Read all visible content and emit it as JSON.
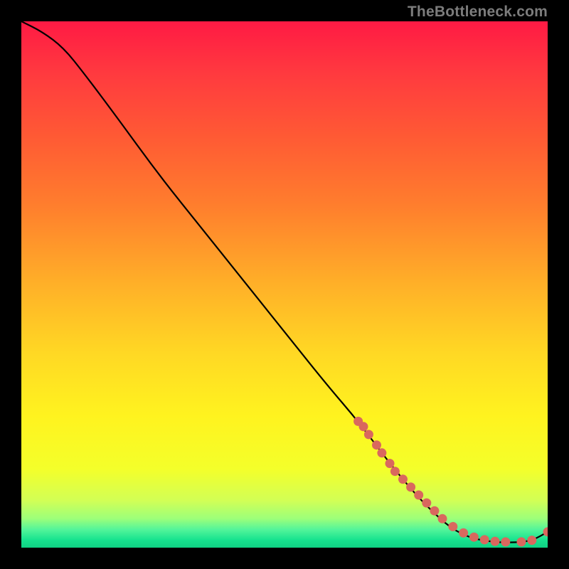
{
  "watermark": "TheBottleneck.com",
  "gradient": {
    "stops": [
      {
        "offset": 0.0,
        "color": "#ff1a44"
      },
      {
        "offset": 0.1,
        "color": "#ff3a3f"
      },
      {
        "offset": 0.22,
        "color": "#ff5a34"
      },
      {
        "offset": 0.35,
        "color": "#ff7e2d"
      },
      {
        "offset": 0.5,
        "color": "#ffb028"
      },
      {
        "offset": 0.63,
        "color": "#ffd824"
      },
      {
        "offset": 0.75,
        "color": "#fff31f"
      },
      {
        "offset": 0.85,
        "color": "#f4ff2a"
      },
      {
        "offset": 0.91,
        "color": "#d2ff55"
      },
      {
        "offset": 0.945,
        "color": "#9cff7a"
      },
      {
        "offset": 0.965,
        "color": "#55f59a"
      },
      {
        "offset": 0.985,
        "color": "#17e38f"
      },
      {
        "offset": 1.0,
        "color": "#0fd183"
      }
    ]
  },
  "chart_data": {
    "type": "line",
    "title": "",
    "xlabel": "",
    "ylabel": "",
    "xlim": [
      0,
      100
    ],
    "ylim": [
      0,
      100
    ],
    "series": [
      {
        "name": "curve",
        "x": [
          0,
          4,
          8,
          12,
          18,
          26,
          34,
          42,
          50,
          58,
          64,
          70,
          75,
          79,
          82,
          85,
          88,
          91,
          94,
          97,
          100
        ],
        "y": [
          100,
          98,
          95,
          90,
          82,
          71,
          61,
          51,
          41,
          31,
          24,
          16,
          10,
          6,
          3.5,
          2,
          1.3,
          1,
          1,
          1.3,
          3
        ]
      }
    ],
    "markers": {
      "name": "dots",
      "color": "#d9685e",
      "radius": 6.5,
      "x": [
        64,
        65,
        66,
        67.5,
        68.5,
        70,
        71,
        72.5,
        74,
        75.5,
        77,
        78.5,
        80,
        82,
        84,
        86,
        88,
        90,
        92,
        95,
        97,
        100
      ],
      "y": [
        24,
        23,
        21.5,
        19.5,
        18,
        16,
        14.5,
        13,
        11.5,
        10,
        8.5,
        7,
        5.5,
        4,
        2.8,
        2,
        1.5,
        1.2,
        1.1,
        1.1,
        1.4,
        3
      ]
    }
  }
}
